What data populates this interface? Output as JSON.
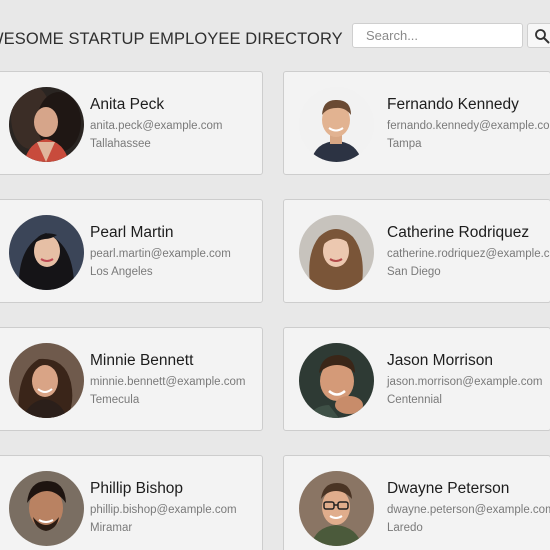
{
  "header": {
    "title": "WESOME STARTUP EMPLOYEE DIRECTORY",
    "search_placeholder": "Search..."
  },
  "employees": [
    {
      "name": "Anita Peck",
      "email": "anita.peck@example.com",
      "city": "Tallahassee"
    },
    {
      "name": "Fernando Kennedy",
      "email": "fernando.kennedy@example.com",
      "city": "Tampa"
    },
    {
      "name": "Pearl Martin",
      "email": "pearl.martin@example.com",
      "city": "Los Angeles"
    },
    {
      "name": "Catherine Rodriquez",
      "email": "catherine.rodriquez@example.com",
      "city": "San Diego"
    },
    {
      "name": "Minnie Bennett",
      "email": "minnie.bennett@example.com",
      "city": "Temecula"
    },
    {
      "name": "Jason Morrison",
      "email": "jason.morrison@example.com",
      "city": "Centennial"
    },
    {
      "name": "Phillip Bishop",
      "email": "phillip.bishop@example.com",
      "city": "Miramar"
    },
    {
      "name": "Dwayne Peterson",
      "email": "dwayne.peterson@example.com",
      "city": "Laredo"
    }
  ],
  "colors": {
    "page_background": "#e8e8e8",
    "card_background": "#f3f3f3",
    "card_border": "#cdcdcd",
    "name_text": "#1d1d1d",
    "detail_text": "#7a7a7a"
  },
  "icons": {
    "search_button": "search-icon"
  }
}
